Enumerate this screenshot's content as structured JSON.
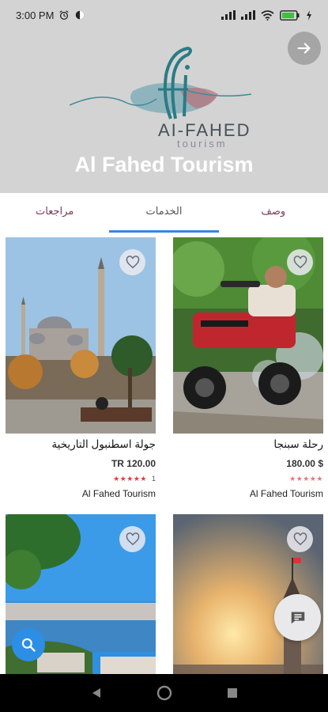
{
  "status_bar": {
    "time": "3:00 PM",
    "icons": [
      "alarm-icon",
      "vpn-icon",
      "signal-icon",
      "signal-icon",
      "wifi-icon",
      "battery-icon",
      "charging-icon"
    ]
  },
  "header": {
    "logo_text": "AI-FAHED",
    "logo_subtext": "tourism",
    "title": "Al Fahed Tourism",
    "background": "#d3d3d3"
  },
  "tabs": [
    {
      "label": "مراجعات",
      "active": false
    },
    {
      "label": "الخدمات",
      "active": true
    },
    {
      "label": "وصف",
      "active": false
    }
  ],
  "cards": [
    {
      "title": "رحلة سبنجا",
      "price": "180.00 $",
      "rating_stars": "★★★★★",
      "rating_filled": false,
      "rating_count": "",
      "vendor": "Al Fahed Tourism",
      "image": "atv-quad-bike-photo"
    },
    {
      "title": "جولة اسطنبول التاريخية",
      "price": "TR 120.00",
      "rating_stars": "★★★★★",
      "rating_filled": true,
      "rating_count": "1",
      "vendor": "Al Fahed Tourism",
      "image": "blue-mosque-photo"
    },
    {
      "title": "",
      "price": "",
      "rating_stars": "",
      "rating_filled": false,
      "rating_count": "",
      "vendor": "",
      "image": "galata-tower-sunset-photo"
    },
    {
      "title": "",
      "price": "",
      "rating_stars": "",
      "rating_filled": false,
      "rating_count": "",
      "vendor": "",
      "image": "bosphorus-view-photo"
    }
  ],
  "colors": {
    "accent": "#3b82e0",
    "fab": "#2d8ee6",
    "star": "#e53a3a",
    "tab_text": "#7a3a5d"
  }
}
